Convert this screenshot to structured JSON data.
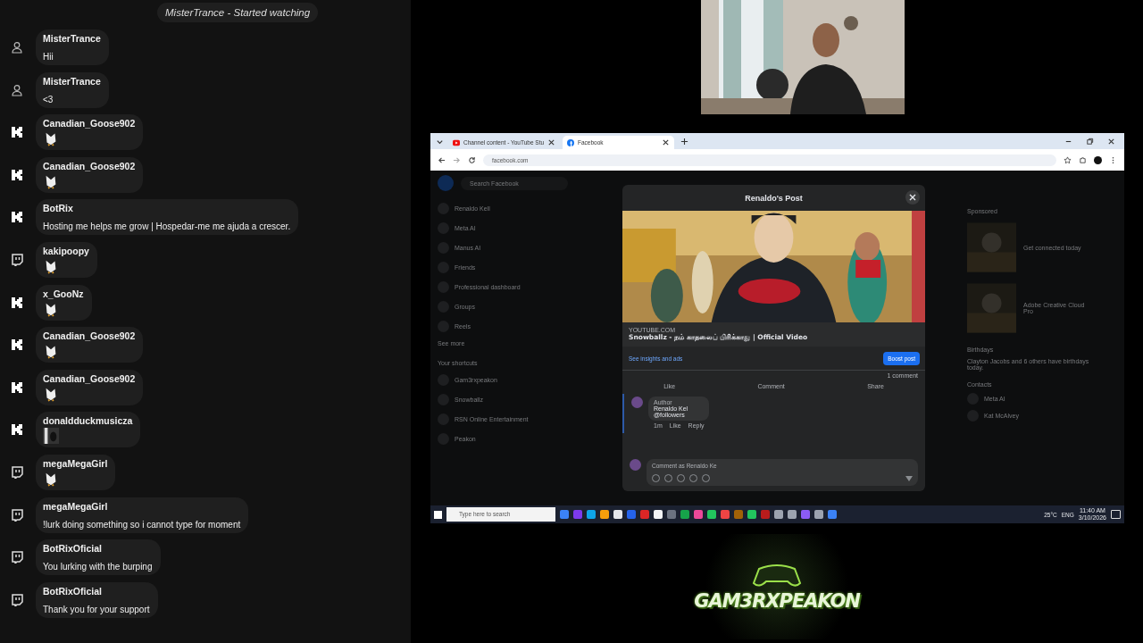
{
  "system_message": "MisterTrance - Started watching",
  "chat": [
    {
      "kind": "viewer",
      "user": "MisterTrance",
      "text": "Hii"
    },
    {
      "kind": "viewer",
      "user": "MisterTrance",
      "text": "<3"
    },
    {
      "kind": "kick",
      "user": "Canadian_Goose902",
      "attachment": {
        "kind": "emote"
      }
    },
    {
      "kind": "kick",
      "user": "Canadian_Goose902",
      "attachment": {
        "kind": "emote"
      }
    },
    {
      "kind": "kick",
      "user": "BotRix",
      "text": "Hosting me helps me grow | Hospedar-me me ajuda a crescer."
    },
    {
      "kind": "twitch",
      "user": "kakipoopy",
      "attachment": {
        "kind": "emote"
      }
    },
    {
      "kind": "kick",
      "user": "x_GooNz",
      "attachment": {
        "kind": "emote"
      }
    },
    {
      "kind": "kick",
      "user": "Canadian_Goose902",
      "attachment": {
        "kind": "emote"
      }
    },
    {
      "kind": "kick",
      "user": "Canadian_Goose902",
      "attachment": {
        "kind": "emote"
      }
    },
    {
      "kind": "kick",
      "user": "donaldduckmusicza"
    },
    {
      "kind": "twitch",
      "user": "megaMegaGirl",
      "attachment": {
        "kind": "emote"
      }
    },
    {
      "kind": "twitch",
      "user": "megaMegaGirl",
      "text": "!lurk doing something so i cannot type for moment"
    },
    {
      "kind": "twitch",
      "user": "BotRixOficial",
      "text": "You lurking with the burping"
    },
    {
      "kind": "twitch",
      "user": "BotRixOficial",
      "text": "Thank you for your support"
    }
  ],
  "browser": {
    "tabs": [
      {
        "title": "Channel content - YouTube Stu",
        "selected": false
      },
      {
        "title": "Facebook",
        "selected": true
      }
    ],
    "url": "facebook.com",
    "search_placeholder": "Search Facebook",
    "sidebar": [
      {
        "label": "Renaldo Kell"
      },
      {
        "label": "Meta AI"
      },
      {
        "label": "Manus AI"
      },
      {
        "label": "Friends"
      },
      {
        "label": "Professional dashboard"
      },
      {
        "label": "Groups"
      },
      {
        "label": "Reels"
      }
    ],
    "see_more": "See more",
    "shortcuts_heading": "Your shortcuts",
    "shortcuts": [
      {
        "label": "Gam3rxpeakon"
      },
      {
        "label": "Snowballz"
      },
      {
        "label": "RSN Online Entertainment"
      },
      {
        "label": "Peakon"
      }
    ],
    "sponsored_heading": "Sponsored",
    "ads": [
      {
        "title": "Get connected today"
      },
      {
        "title": "Adobe Creative Cloud Pro"
      }
    ],
    "birthdays_heading": "Birthdays",
    "birthday_text": "Clayton Jacobs and 6 others have birthdays today.",
    "contacts_heading": "Contacts",
    "contacts": [
      {
        "name": "Meta AI"
      },
      {
        "name": "Kat McAlvey"
      }
    ],
    "post": {
      "title": "Renaldo's Post",
      "source": "YOUTUBE.COM",
      "headline": "Snowballz - நம் காதலைப் பிரிக்காது | Official Video",
      "insights": "See insights and ads",
      "boost": "Boost post",
      "comment_count": "1 comment",
      "actions": [
        "Like",
        "Comment",
        "Share"
      ],
      "comment": {
        "badge": "Author",
        "author": "Renaldo Kel",
        "text": "@followers",
        "time": "1m",
        "like": "Like",
        "reply": "Reply"
      },
      "comment_placeholder": "Comment as Renaldo Ke"
    },
    "taskbar": {
      "search_placeholder": "Type here to search",
      "weather": "25°C",
      "language": "ENG",
      "time": "11:40 AM",
      "date": "3/10/2026"
    }
  },
  "logo_text": "GAM3RXPEAKON"
}
